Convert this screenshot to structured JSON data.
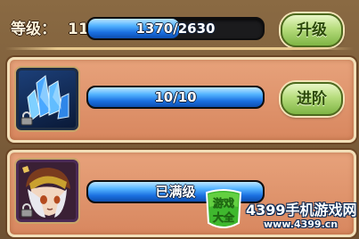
{
  "header": {
    "level_label": "等级：",
    "level_value": "11",
    "xp": {
      "text": "1370/2630",
      "current": 1370,
      "max": 2630
    },
    "upgrade_label": "升级"
  },
  "crystal_panel": {
    "icon": "blue-crystal-icon",
    "progress": {
      "text": "10/10",
      "fraction": 1.0
    },
    "advance_label": "进阶"
  },
  "hero_panel": {
    "icon": "hero-portrait-icon",
    "progress": {
      "text": "已满级",
      "fraction": 1.0
    }
  },
  "watermark": {
    "badge_text": "游戏大全",
    "brand": "4399手机游戏网",
    "url": "www.4399.cn"
  },
  "colors": {
    "bar_fill": "#1a6fe0",
    "button_green": "#b6dc7c",
    "panel": "#e7a27b",
    "background": "#7a5a38"
  }
}
